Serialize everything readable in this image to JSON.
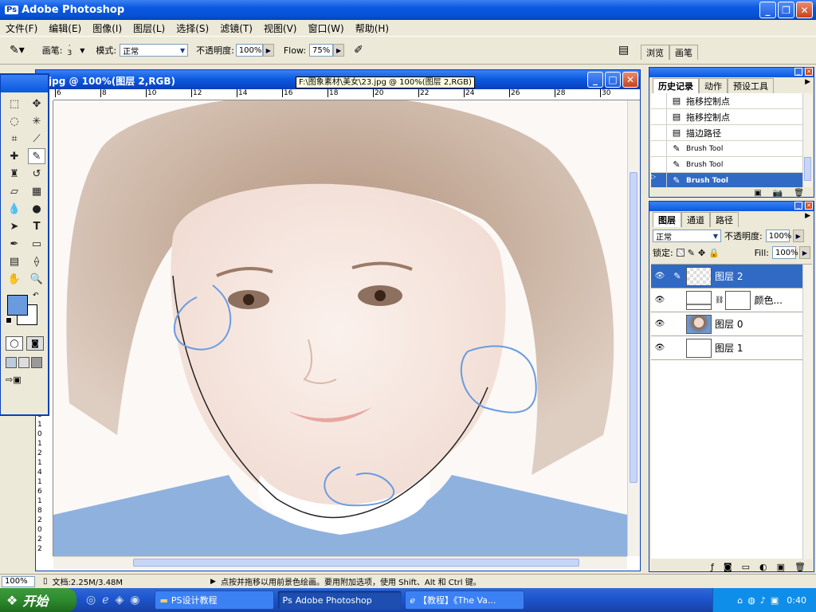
{
  "app": {
    "title": "Adobe Photoshop"
  },
  "menu": [
    "文件(F)",
    "编辑(E)",
    "图像(I)",
    "图层(L)",
    "选择(S)",
    "滤镜(T)",
    "视图(V)",
    "窗口(W)",
    "帮助(H)"
  ],
  "options": {
    "brush_label": "画笔:",
    "brush_size": "3",
    "mode_label": "模式:",
    "mode_value": "正常",
    "opacity_label": "不透明度:",
    "opacity_value": "100%",
    "flow_label": "Flow:",
    "flow_value": "75%",
    "palette_tabs": [
      "浏览",
      "画笔"
    ]
  },
  "document": {
    "title": "jpg @ 100%(图层 2,RGB)",
    "tooltip": "F:\\图象素材\\美女\\23.jpg @ 100%(图层 2,RGB)",
    "ruler_top": [
      "6",
      "8",
      "10",
      "12",
      "14",
      "16",
      "18",
      "20",
      "22",
      "24",
      "26",
      "28",
      "30"
    ],
    "ruler_left": [
      "8",
      "1",
      "0",
      "1",
      "2",
      "1",
      "4",
      "1",
      "6",
      "1",
      "8",
      "2",
      "0",
      "2",
      "2"
    ]
  },
  "history": {
    "tabs": [
      "历史记录",
      "动作",
      "预设工具"
    ],
    "items": [
      {
        "label": "拖移控制点",
        "selected": false
      },
      {
        "label": "拖移控制点",
        "selected": false
      },
      {
        "label": "描边路径",
        "selected": false
      },
      {
        "label": "Brush Tool",
        "selected": false
      },
      {
        "label": "Brush Tool",
        "selected": false
      },
      {
        "label": "Brush Tool",
        "selected": true
      }
    ]
  },
  "layers": {
    "tabs": [
      "图层",
      "通道",
      "路径"
    ],
    "blend_mode": "正常",
    "opacity_label": "不透明度:",
    "opacity_value": "100%",
    "lock_label": "锁定:",
    "fill_label": "Fill:",
    "fill_value": "100%",
    "items": [
      {
        "label": "图层 2",
        "selected": true
      },
      {
        "label": "颜色...",
        "selected": false
      },
      {
        "label": "图层 0",
        "selected": false
      },
      {
        "label": "图层 1",
        "selected": false
      }
    ]
  },
  "status": {
    "zoom": "100%",
    "doc_size": "文档:2.25M/3.48M",
    "hint": "点按并拖移以用前景色绘画。要用附加选项，使用 Shift、Alt 和 Ctrl 键。"
  },
  "taskbar": {
    "start": "开始",
    "tasks": [
      {
        "label": "PS设计教程",
        "active": false
      },
      {
        "label": "Adobe Photoshop",
        "active": true
      },
      {
        "label": "【教程】《The Va...",
        "active": false
      }
    ],
    "clock": "0:40"
  },
  "colors": {
    "foreground": "#6a9bdf",
    "background": "#ffffff",
    "accent": "#0a58e0",
    "selection": "#316ac5"
  }
}
